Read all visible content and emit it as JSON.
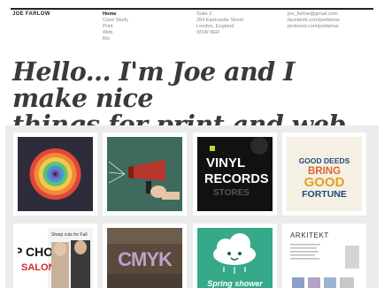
{
  "header": {
    "brand": "JOE FARLOW",
    "nav": [
      {
        "label": "Home",
        "active": true
      },
      {
        "label": "Case Study",
        "active": false
      },
      {
        "label": "Print",
        "active": false
      },
      {
        "label": "Web",
        "active": false
      },
      {
        "label": "Bio",
        "active": false
      }
    ],
    "address": [
      "Suite 2",
      "354 Eastcastle Street",
      "London, England",
      "W1W 8ER"
    ],
    "contacts": [
      "joe_farlow@gmail.com",
      "facebook.com/joefarlow",
      "pinterest.com/joefarlow"
    ]
  },
  "headline": {
    "line1": "Hello... I'm Joe and I make nice",
    "line2_prefix": "things for ",
    "link_print": "print",
    "line2_middle": " and ",
    "link_web": "web",
    "line2_suffix": "."
  },
  "gallery": {
    "tiles": [
      {
        "name": "rainbow-circle"
      },
      {
        "name": "megaphone"
      },
      {
        "name": "vinyl-records",
        "text_top": "VINYL",
        "text_bottom": "RECORDS",
        "text_sub": "STORES"
      },
      {
        "name": "good-deeds",
        "lines": [
          "GOOD DEEDS",
          "BRING",
          "GOOD",
          "FORTUNE"
        ]
      },
      {
        "name": "chop-salon",
        "big_text": "P CHOP",
        "side_text": "SALON",
        "headline": "Sharp cuts for Fall"
      },
      {
        "name": "cmyk-letters",
        "text": "CMYK"
      },
      {
        "name": "spring-shower",
        "text": "Spring shower"
      },
      {
        "name": "arkitekt",
        "text": "ARKITEKT"
      }
    ]
  }
}
